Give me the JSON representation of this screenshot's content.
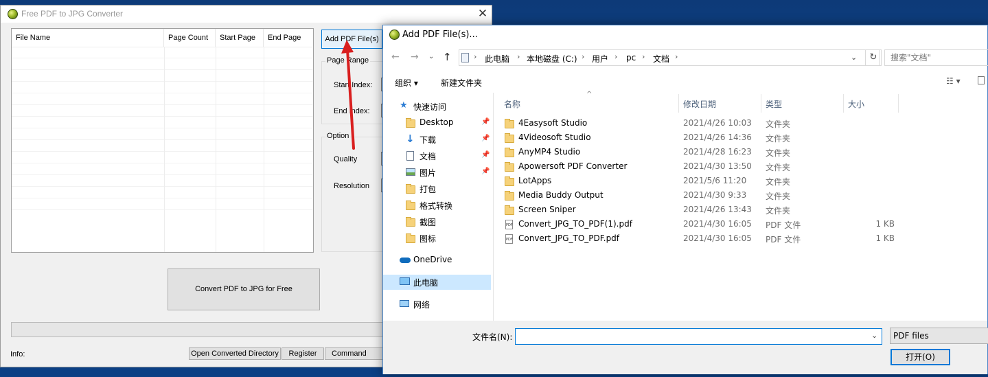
{
  "main_window": {
    "title": "Free PDF to JPG Converter",
    "close_glyph": "✕",
    "file_list_columns": [
      "File Name",
      "Page Count",
      "Start Page",
      "End Page"
    ],
    "add_pdf_label": "Add PDF File(s)",
    "page_range_label": "Page Range",
    "start_index_label": "Start Index:",
    "end_index_label": "End Index:",
    "option_label": "Option",
    "quality_label": "Quality",
    "resolution_label": "Resolution",
    "convert_label": "Convert PDF to JPG for Free",
    "info_label": "Info:",
    "open_dir_label": "Open Converted Directory",
    "register_label": "Register",
    "cmdline_label": "Command Line,"
  },
  "dialog": {
    "title": "Add PDF File(s)...",
    "breadcrumb": [
      "此电脑",
      "本地磁盘 (C:)",
      "用户",
      "pc",
      "文档"
    ],
    "search_placeholder": "搜索\"文档\"",
    "toolbar": {
      "organize": "组织 ▾",
      "new_folder": "新建文件夹"
    },
    "nav": [
      {
        "label": "快速访问",
        "icon": "star-icon"
      },
      {
        "label": "Desktop",
        "icon": "folder-icon",
        "pinned": true
      },
      {
        "label": "下载",
        "icon": "download-arrow-icon",
        "pinned": true
      },
      {
        "label": "文档",
        "icon": "document-icon",
        "pinned": true
      },
      {
        "label": "图片",
        "icon": "picture-icon",
        "pinned": true
      },
      {
        "label": "打包",
        "icon": "folder-icon"
      },
      {
        "label": "格式转换",
        "icon": "folder-icon"
      },
      {
        "label": "截图",
        "icon": "folder-icon"
      },
      {
        "label": "图标",
        "icon": "folder-icon"
      },
      {
        "label": "OneDrive",
        "icon": "cloud-icon"
      },
      {
        "label": "此电脑",
        "icon": "computer-icon",
        "selected": true
      },
      {
        "label": "网络",
        "icon": "network-icon"
      }
    ],
    "columns": [
      "名称",
      "修改日期",
      "类型",
      "大小"
    ],
    "files": [
      {
        "name": "4Easysoft Studio",
        "date": "2021/4/26 10:03",
        "type": "文件夹",
        "size": "",
        "kind": "folder"
      },
      {
        "name": "4Videosoft Studio",
        "date": "2021/4/26 14:36",
        "type": "文件夹",
        "size": "",
        "kind": "folder"
      },
      {
        "name": "AnyMP4 Studio",
        "date": "2021/4/28 16:23",
        "type": "文件夹",
        "size": "",
        "kind": "folder"
      },
      {
        "name": "Apowersoft PDF Converter",
        "date": "2021/4/30 13:50",
        "type": "文件夹",
        "size": "",
        "kind": "folder"
      },
      {
        "name": "LotApps",
        "date": "2021/5/6 11:20",
        "type": "文件夹",
        "size": "",
        "kind": "folder"
      },
      {
        "name": "Media Buddy Output",
        "date": "2021/4/30 9:33",
        "type": "文件夹",
        "size": "",
        "kind": "folder"
      },
      {
        "name": "Screen Sniper",
        "date": "2021/4/26 13:43",
        "type": "文件夹",
        "size": "",
        "kind": "folder"
      },
      {
        "name": "Convert_JPG_TO_PDF(1).pdf",
        "date": "2021/4/30 16:05",
        "type": "PDF 文件",
        "size": "1 KB",
        "kind": "pdf"
      },
      {
        "name": "Convert_JPG_TO_PDF.pdf",
        "date": "2021/4/30 16:05",
        "type": "PDF 文件",
        "size": "1 KB",
        "kind": "pdf"
      }
    ],
    "filename_label": "文件名(N):",
    "filename_value": "",
    "filetype_value": "PDF files",
    "open_label": "打开(O)"
  }
}
